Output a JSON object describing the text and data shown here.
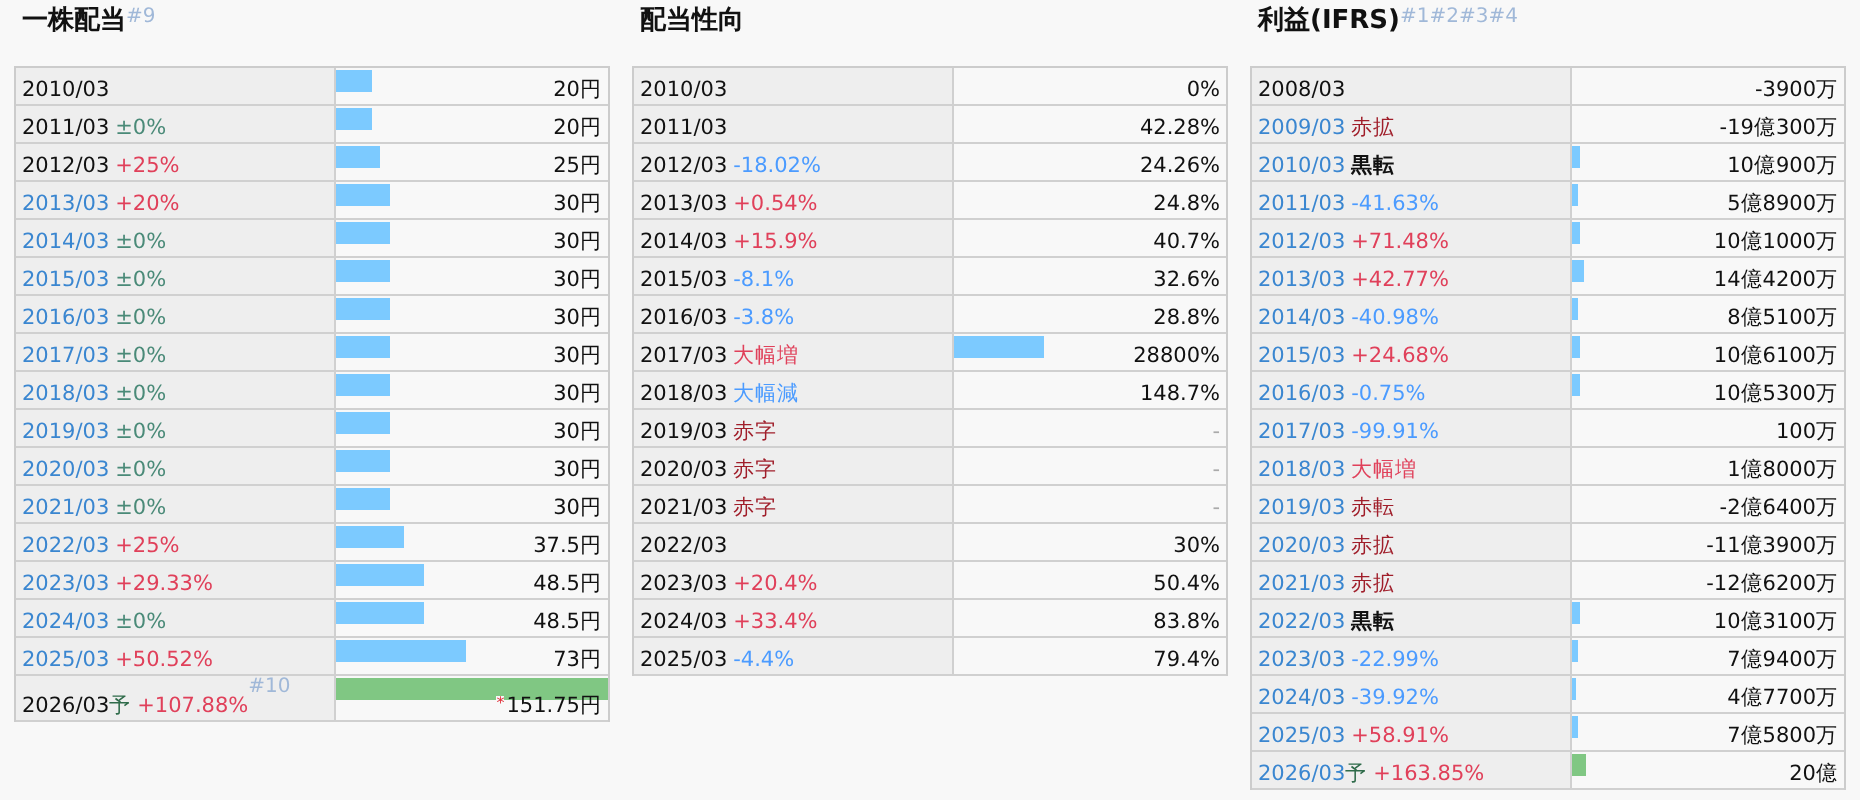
{
  "panels": [
    {
      "title": "一株配当",
      "note": "#9",
      "rows": [
        {
          "year": "2010/03",
          "year_link": false,
          "bar": {
            "level": 0.13,
            "color": "#7ccaff"
          },
          "value": "20円"
        },
        {
          "year": "2011/03",
          "year_link": false,
          "change": {
            "text": "±0%",
            "kind": "flat"
          },
          "bar": {
            "level": 0.13,
            "color": "#7ccaff"
          },
          "value": "20円"
        },
        {
          "year": "2012/03",
          "year_link": false,
          "change": {
            "text": "+25%",
            "kind": "up"
          },
          "bar": {
            "level": 0.16,
            "color": "#7ccaff"
          },
          "value": "25円"
        },
        {
          "year": "2013/03",
          "year_link": true,
          "change": {
            "text": "+20%",
            "kind": "up"
          },
          "bar": {
            "level": 0.2,
            "color": "#7ccaff"
          },
          "value": "30円"
        },
        {
          "year": "2014/03",
          "year_link": true,
          "change": {
            "text": "±0%",
            "kind": "flat"
          },
          "bar": {
            "level": 0.2,
            "color": "#7ccaff"
          },
          "value": "30円"
        },
        {
          "year": "2015/03",
          "year_link": true,
          "change": {
            "text": "±0%",
            "kind": "flat"
          },
          "bar": {
            "level": 0.2,
            "color": "#7ccaff"
          },
          "value": "30円"
        },
        {
          "year": "2016/03",
          "year_link": true,
          "change": {
            "text": "±0%",
            "kind": "flat"
          },
          "bar": {
            "level": 0.2,
            "color": "#7ccaff"
          },
          "value": "30円"
        },
        {
          "year": "2017/03",
          "year_link": true,
          "change": {
            "text": "±0%",
            "kind": "flat"
          },
          "bar": {
            "level": 0.2,
            "color": "#7ccaff"
          },
          "value": "30円"
        },
        {
          "year": "2018/03",
          "year_link": true,
          "change": {
            "text": "±0%",
            "kind": "flat"
          },
          "bar": {
            "level": 0.2,
            "color": "#7ccaff"
          },
          "value": "30円"
        },
        {
          "year": "2019/03",
          "year_link": true,
          "change": {
            "text": "±0%",
            "kind": "flat"
          },
          "bar": {
            "level": 0.2,
            "color": "#7ccaff"
          },
          "value": "30円"
        },
        {
          "year": "2020/03",
          "year_link": true,
          "change": {
            "text": "±0%",
            "kind": "flat"
          },
          "bar": {
            "level": 0.2,
            "color": "#7ccaff"
          },
          "value": "30円"
        },
        {
          "year": "2021/03",
          "year_link": true,
          "change": {
            "text": "±0%",
            "kind": "flat"
          },
          "bar": {
            "level": 0.2,
            "color": "#7ccaff"
          },
          "value": "30円"
        },
        {
          "year": "2022/03",
          "year_link": true,
          "change": {
            "text": "+25%",
            "kind": "up"
          },
          "bar": {
            "level": 0.25,
            "color": "#7ccaff"
          },
          "value": "37.5円"
        },
        {
          "year": "2023/03",
          "year_link": true,
          "change": {
            "text": "+29.33%",
            "kind": "up"
          },
          "bar": {
            "level": 0.32,
            "color": "#7ccaff"
          },
          "value": "48.5円"
        },
        {
          "year": "2024/03",
          "year_link": true,
          "change": {
            "text": "±0%",
            "kind": "flat"
          },
          "bar": {
            "level": 0.32,
            "color": "#7ccaff"
          },
          "value": "48.5円"
        },
        {
          "year": "2025/03",
          "year_link": true,
          "change": {
            "text": "+50.52%",
            "kind": "up"
          },
          "bar": {
            "level": 0.48,
            "color": "#7ccaff"
          },
          "value": "73円"
        },
        {
          "year": "2026/03",
          "year_link": false,
          "forecast": "予",
          "change": {
            "text": "+107.88%",
            "kind": "up"
          },
          "note": "#10",
          "bar": {
            "level": 1,
            "color": "#80c783"
          },
          "mark": "*",
          "value": "151.75円"
        }
      ]
    },
    {
      "title": "配当性向",
      "rows": [
        {
          "year": "2010/03",
          "year_link": false,
          "value": "0%"
        },
        {
          "year": "2011/03",
          "year_link": false,
          "value": "42.28%"
        },
        {
          "year": "2012/03",
          "year_link": false,
          "change": {
            "text": "-18.02%",
            "kind": "down"
          },
          "value": "24.26%"
        },
        {
          "year": "2013/03",
          "year_link": false,
          "change": {
            "text": "+0.54%",
            "kind": "up"
          },
          "value": "24.8%"
        },
        {
          "year": "2014/03",
          "year_link": false,
          "change": {
            "text": "+15.9%",
            "kind": "up"
          },
          "value": "40.7%"
        },
        {
          "year": "2015/03",
          "year_link": false,
          "change": {
            "text": "-8.1%",
            "kind": "down"
          },
          "value": "32.6%"
        },
        {
          "year": "2016/03",
          "year_link": false,
          "change": {
            "text": "-3.8%",
            "kind": "down"
          },
          "value": "28.8%"
        },
        {
          "year": "2017/03",
          "year_link": false,
          "change": {
            "text": "大幅増",
            "kind": "up"
          },
          "bar": {
            "level": 0.33,
            "color": "#7ccaff"
          },
          "value": "28800%"
        },
        {
          "year": "2018/03",
          "year_link": false,
          "change": {
            "text": "大幅減",
            "kind": "down"
          },
          "value": "148.7%"
        },
        {
          "year": "2019/03",
          "year_link": false,
          "change": {
            "text": "赤字",
            "kind": "deficit"
          },
          "value": "-",
          "muted": true
        },
        {
          "year": "2020/03",
          "year_link": false,
          "change": {
            "text": "赤字",
            "kind": "deficit"
          },
          "value": "-",
          "muted": true
        },
        {
          "year": "2021/03",
          "year_link": false,
          "change": {
            "text": "赤字",
            "kind": "deficit"
          },
          "value": "-",
          "muted": true
        },
        {
          "year": "2022/03",
          "year_link": false,
          "value": "30%"
        },
        {
          "year": "2023/03",
          "year_link": false,
          "change": {
            "text": "+20.4%",
            "kind": "up"
          },
          "value": "50.4%"
        },
        {
          "year": "2024/03",
          "year_link": false,
          "change": {
            "text": "+33.4%",
            "kind": "up"
          },
          "value": "83.8%"
        },
        {
          "year": "2025/03",
          "year_link": false,
          "change": {
            "text": "-4.4%",
            "kind": "down"
          },
          "value": "79.4%"
        }
      ]
    },
    {
      "title": "利益(IFRS)",
      "note": "#1#2#3#4",
      "rows": [
        {
          "year": "2008/03",
          "year_link": false,
          "value": "-3900万"
        },
        {
          "year": "2009/03",
          "year_link": true,
          "change": {
            "text": "赤拡",
            "kind": "deficit"
          },
          "value": "-19億300万"
        },
        {
          "year": "2010/03",
          "year_link": true,
          "change": {
            "text": "黒転",
            "kind": "surplus"
          },
          "bar": {
            "level": 0.03,
            "color": "#7ccaff"
          },
          "value": "10億900万"
        },
        {
          "year": "2011/03",
          "year_link": true,
          "change": {
            "text": "-41.63%",
            "kind": "down"
          },
          "bar": {
            "level": 0.02,
            "color": "#7ccaff"
          },
          "value": "5億8900万"
        },
        {
          "year": "2012/03",
          "year_link": true,
          "change": {
            "text": "+71.48%",
            "kind": "up"
          },
          "bar": {
            "level": 0.03,
            "color": "#7ccaff"
          },
          "value": "10億1000万"
        },
        {
          "year": "2013/03",
          "year_link": true,
          "change": {
            "text": "+42.77%",
            "kind": "up"
          },
          "bar": {
            "level": 0.045,
            "color": "#7ccaff"
          },
          "value": "14億4200万"
        },
        {
          "year": "2014/03",
          "year_link": true,
          "change": {
            "text": "-40.98%",
            "kind": "down"
          },
          "bar": {
            "level": 0.02,
            "color": "#7ccaff"
          },
          "value": "8億5100万"
        },
        {
          "year": "2015/03",
          "year_link": true,
          "change": {
            "text": "+24.68%",
            "kind": "up"
          },
          "bar": {
            "level": 0.03,
            "color": "#7ccaff"
          },
          "value": "10億6100万"
        },
        {
          "year": "2016/03",
          "year_link": true,
          "change": {
            "text": "-0.75%",
            "kind": "down"
          },
          "bar": {
            "level": 0.03,
            "color": "#7ccaff"
          },
          "value": "10億5300万"
        },
        {
          "year": "2017/03",
          "year_link": true,
          "change": {
            "text": "-99.91%",
            "kind": "down"
          },
          "value": "100万"
        },
        {
          "year": "2018/03",
          "year_link": true,
          "change": {
            "text": "大幅増",
            "kind": "up"
          },
          "value": "1億8000万"
        },
        {
          "year": "2019/03",
          "year_link": true,
          "change": {
            "text": "赤転",
            "kind": "deficit"
          },
          "value": "-2億6400万"
        },
        {
          "year": "2020/03",
          "year_link": true,
          "change": {
            "text": "赤拡",
            "kind": "deficit"
          },
          "value": "-11億3900万"
        },
        {
          "year": "2021/03",
          "year_link": true,
          "change": {
            "text": "赤拡",
            "kind": "deficit"
          },
          "value": "-12億6200万"
        },
        {
          "year": "2022/03",
          "year_link": true,
          "change": {
            "text": "黒転",
            "kind": "surplus"
          },
          "bar": {
            "level": 0.03,
            "color": "#7ccaff"
          },
          "value": "10億3100万"
        },
        {
          "year": "2023/03",
          "year_link": true,
          "change": {
            "text": "-22.99%",
            "kind": "down"
          },
          "bar": {
            "level": 0.022,
            "color": "#7ccaff"
          },
          "value": "7億9400万"
        },
        {
          "year": "2024/03",
          "year_link": true,
          "change": {
            "text": "-39.92%",
            "kind": "down"
          },
          "bar": {
            "level": 0.015,
            "color": "#7ccaff"
          },
          "value": "4億7700万"
        },
        {
          "year": "2025/03",
          "year_link": true,
          "change": {
            "text": "+58.91%",
            "kind": "up"
          },
          "bar": {
            "level": 0.022,
            "color": "#7ccaff"
          },
          "value": "7億5800万"
        },
        {
          "year": "2026/03",
          "year_link": true,
          "forecast": "予",
          "change": {
            "text": "+163.85%",
            "kind": "up"
          },
          "bar": {
            "level": 0.05,
            "color": "#80c783"
          },
          "value": "20億"
        }
      ]
    }
  ]
}
